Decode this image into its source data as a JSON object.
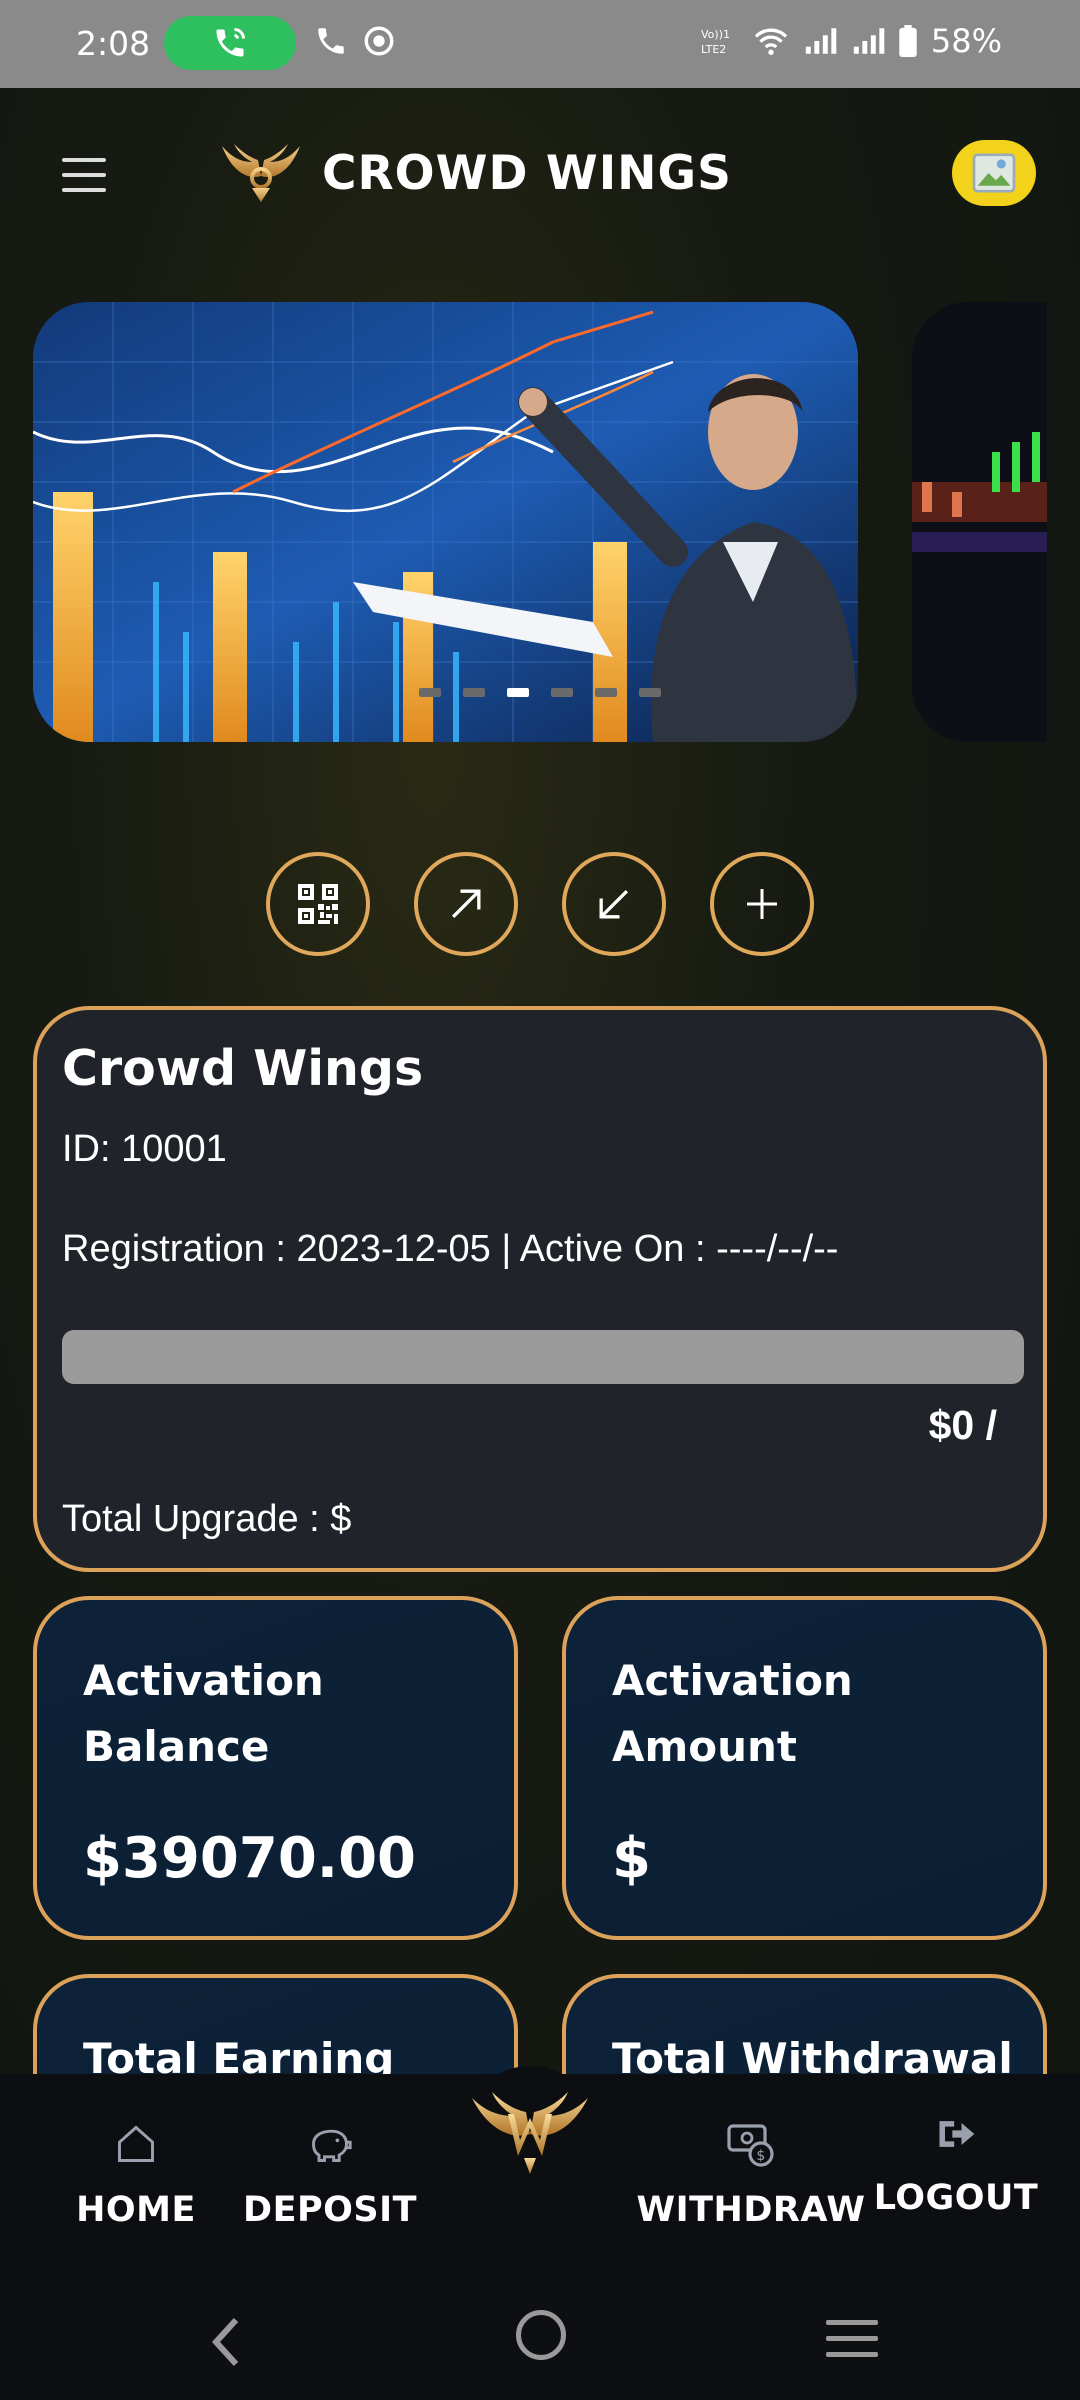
{
  "status_bar": {
    "time": "2:08",
    "network_label": "VoLTE2",
    "battery": "58%"
  },
  "header": {
    "title": "CROWD WINGS"
  },
  "carousel": {
    "slide_count": 6,
    "active_index": 2
  },
  "profile": {
    "name": "Crowd Wings",
    "id_text": "ID: 10001",
    "registration_text": "Registration : 2023-12-05 | Active On : ----/--/--",
    "progress_fraction": 0,
    "amount_text": "$0 /",
    "upgrade_text": "Total Upgrade : $"
  },
  "stats": [
    {
      "title_line1": "Activation",
      "title_line2": "Balance",
      "value": "$39070.00"
    },
    {
      "title_line1": "Activation",
      "title_line2": "Amount",
      "value": "$"
    },
    {
      "title_line1": "Total Earning",
      "title_line2": "",
      "value": ""
    },
    {
      "title_line1": "Total Withdrawal",
      "title_line2": "",
      "value": ""
    }
  ],
  "bottom_nav": {
    "home": "HOME",
    "deposit": "DEPOSIT",
    "withdraw": "WITHDRAW",
    "logout": "LOGOUT"
  },
  "colors": {
    "accent": "#dca25a",
    "call_green": "#2ec05f",
    "avatar_yellow": "#f2d21b",
    "card_bg": "#20232a",
    "stat_bg": "#0d2238"
  },
  "icons": {
    "actions": [
      "qr-code-icon",
      "arrow-up-right-icon",
      "arrow-down-left-icon",
      "plus-icon"
    ]
  }
}
